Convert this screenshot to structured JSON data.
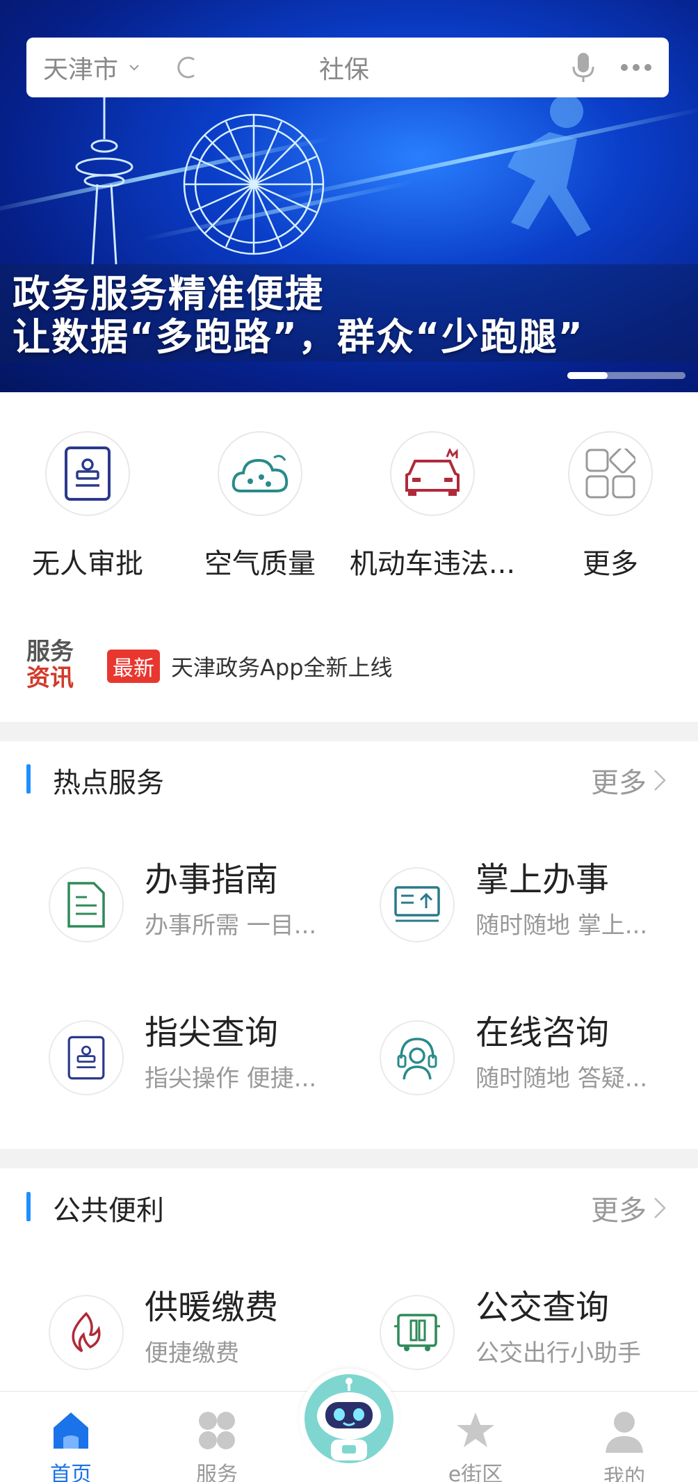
{
  "search": {
    "city": "天津市",
    "keyword": "社保"
  },
  "banner": {
    "line1": "政务服务精准便捷",
    "line2": "让数据“多跑路”，群众“少跑腿”"
  },
  "quick_actions": [
    {
      "label": "无人审批",
      "icon": "stamp-icon"
    },
    {
      "label": "空气质量",
      "icon": "cloud-icon"
    },
    {
      "label": "机动车违法...",
      "icon": "car-icon"
    },
    {
      "label": "更多",
      "icon": "grid-icon"
    }
  ],
  "news": {
    "logo_line1": "服务",
    "logo_line2": "资讯",
    "tag": "最新",
    "headline": "天津政务App全新上线"
  },
  "hot_services": {
    "title": "热点服务",
    "more": "更多",
    "items": [
      {
        "title": "办事指南",
        "subtitle": "办事所需  一目...",
        "icon": "document-icon"
      },
      {
        "title": "掌上办事",
        "subtitle": "随时随地 掌上...",
        "icon": "upload-panel-icon"
      },
      {
        "title": "指尖查询",
        "subtitle": "指尖操作 便捷...",
        "icon": "stamp-icon"
      },
      {
        "title": "在线咨询",
        "subtitle": "随时随地 答疑...",
        "icon": "headset-icon"
      }
    ]
  },
  "public_services": {
    "title": "公共便利",
    "more": "更多",
    "items": [
      {
        "title": "供暖缴费",
        "subtitle": "便捷缴费",
        "icon": "flame-icon"
      },
      {
        "title": "公交查询",
        "subtitle": "公交出行小助手",
        "icon": "bus-icon"
      }
    ]
  },
  "tabbar": [
    {
      "label": "首页",
      "icon": "home-icon",
      "active": true
    },
    {
      "label": "服务",
      "icon": "clover-icon",
      "active": false
    },
    {
      "label": "e街区",
      "icon": "star-icon",
      "active": false
    },
    {
      "label": "我的",
      "icon": "user-icon",
      "active": false
    }
  ],
  "colors": {
    "accent": "#1a73e8",
    "section_bar": "#1f8fff",
    "tag_red": "#e8372f"
  }
}
